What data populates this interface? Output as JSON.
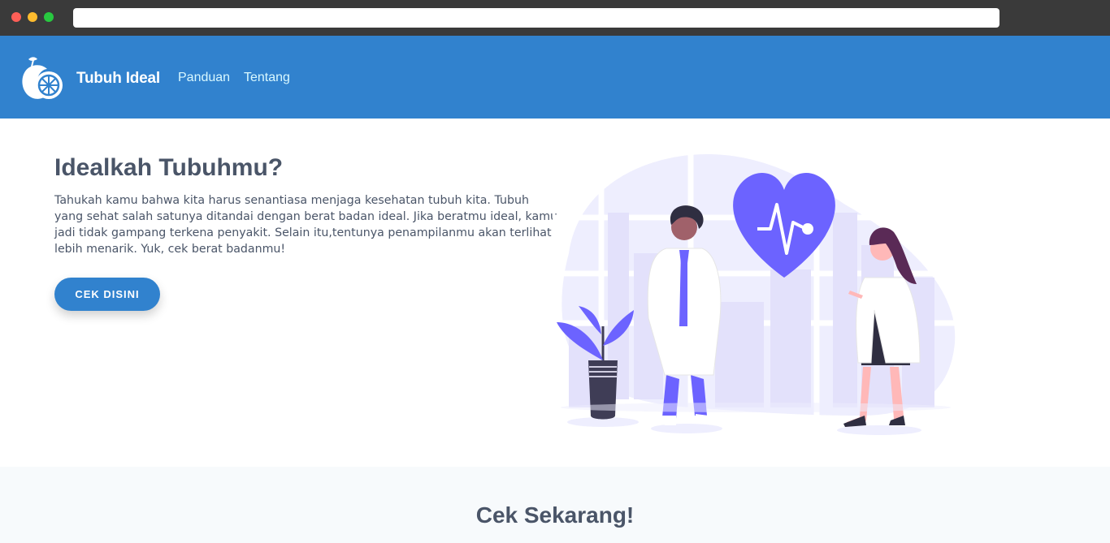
{
  "browser": {
    "url": ""
  },
  "navbar": {
    "brand": "Tubuh Ideal",
    "links": [
      {
        "label": "Panduan"
      },
      {
        "label": "Tentang"
      }
    ],
    "logo_icon": "lemon-icon"
  },
  "hero": {
    "title": "Idealkah Tubuhmu?",
    "text": "Tahukah kamu bahwa kita harus senantiasa menjaga kesehatan tubuh kita. Tubuh yang sehat salah satunya ditandai dengan berat badan ideal. Jika beratmu ideal, kamu jadi tidak gampang terkena penyakit. Selain itu,tentunya penampilanmu akan terlihat lebih menarik. Yuk, cek berat badanmu!",
    "cta_label": "CEK DISINI",
    "illustration": "doctors-heart-illustration"
  },
  "section2": {
    "title": "Cek Sekarang!"
  },
  "colors": {
    "primary": "#3182ce",
    "text": "#4a5568",
    "accent": "#6c63ff",
    "section_bg": "#f7fafc"
  }
}
